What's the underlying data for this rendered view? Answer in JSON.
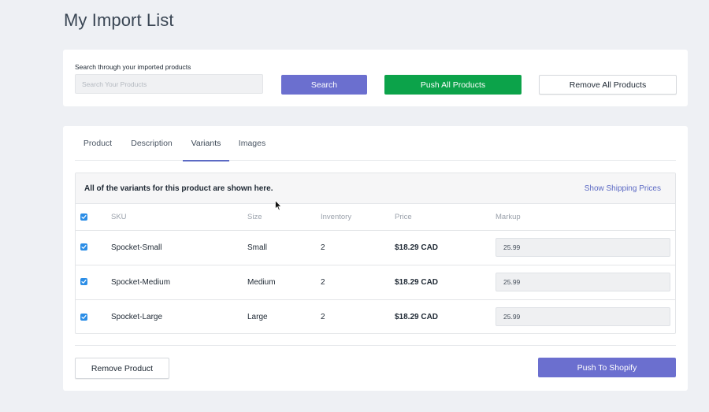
{
  "page": {
    "title": "My Import List"
  },
  "search": {
    "label": "Search through your imported products",
    "placeholder": "Search Your Products",
    "value": "",
    "search_button": "Search",
    "push_all_button": "Push All Products",
    "remove_all_button": "Remove All Products"
  },
  "tabs": [
    {
      "label": "Product",
      "active": false
    },
    {
      "label": "Description",
      "active": false
    },
    {
      "label": "Variants",
      "active": true
    },
    {
      "label": "Images",
      "active": false
    }
  ],
  "variants": {
    "info": "All of the variants for this product are shown here.",
    "shipping_link": "Show Shipping Prices",
    "columns": [
      "SKU",
      "Size",
      "Inventory",
      "Price",
      "Markup"
    ],
    "rows": [
      {
        "checked": true,
        "sku": "Spocket-Small",
        "size": "Small",
        "inventory": "2",
        "price": "$18.29 CAD",
        "markup": "25.99"
      },
      {
        "checked": true,
        "sku": "Spocket-Medium",
        "size": "Medium",
        "inventory": "2",
        "price": "$18.29 CAD",
        "markup": "25.99"
      },
      {
        "checked": true,
        "sku": "Spocket-Large",
        "size": "Large",
        "inventory": "2",
        "price": "$18.29 CAD",
        "markup": "25.99"
      }
    ]
  },
  "actions": {
    "remove_product_button": "Remove Product",
    "push_to_shopify_button": "Push To Shopify"
  },
  "colors": {
    "accent": "#6b6fcf",
    "success": "#0ca34a",
    "link": "#5c6ac4",
    "checkbox": "#2b8de6",
    "background": "#eef0f4"
  }
}
